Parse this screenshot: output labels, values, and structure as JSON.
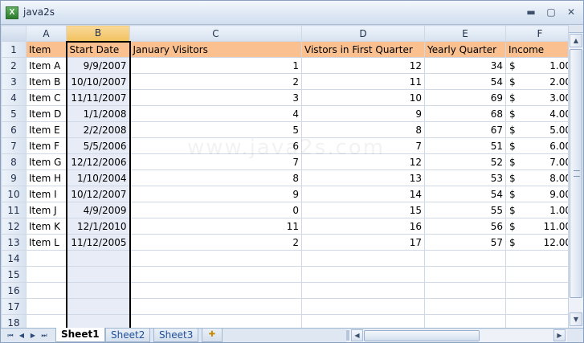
{
  "window": {
    "title": "java2s",
    "app_icon": "excel-icon",
    "minimize": "▬",
    "maximize": "▢",
    "close": "✕"
  },
  "watermark": "www.java2s.com",
  "columns": [
    "A",
    "B",
    "C",
    "D",
    "E",
    "F"
  ],
  "selected_column": "B",
  "rows": [
    "1",
    "2",
    "3",
    "4",
    "5",
    "6",
    "7",
    "8",
    "9",
    "10",
    "11",
    "12",
    "13",
    "14",
    "15",
    "16",
    "17",
    "18"
  ],
  "header": [
    "Item",
    "Start Date",
    "January Visitors",
    "Vistors in First Quarter",
    "Yearly Quarter",
    "Income"
  ],
  "data": [
    [
      "Item A",
      "9/9/2007",
      "1",
      "12",
      "34",
      "$",
      "1.00"
    ],
    [
      "Item B",
      "10/10/2007",
      "2",
      "11",
      "54",
      "$",
      "2.00"
    ],
    [
      "Item C",
      "11/11/2007",
      "3",
      "10",
      "69",
      "$",
      "3.00"
    ],
    [
      "Item D",
      "1/1/2008",
      "4",
      "9",
      "68",
      "$",
      "4.00"
    ],
    [
      "Item E",
      "2/2/2008",
      "5",
      "8",
      "67",
      "$",
      "5.00"
    ],
    [
      "Item F",
      "5/5/2006",
      "6",
      "7",
      "51",
      "$",
      "6.00"
    ],
    [
      "Item G",
      "12/12/2006",
      "7",
      "12",
      "52",
      "$",
      "7.00"
    ],
    [
      "Item H",
      "1/10/2004",
      "8",
      "13",
      "53",
      "$",
      "8.00"
    ],
    [
      "Item I",
      "10/12/2007",
      "9",
      "14",
      "54",
      "$",
      "9.00"
    ],
    [
      "Item J",
      "4/9/2009",
      "0",
      "15",
      "55",
      "$",
      "1.00"
    ],
    [
      "Item K",
      "12/1/2010",
      "11",
      "16",
      "56",
      "$",
      "11.00"
    ],
    [
      "Item L",
      "11/12/2005",
      "2",
      "17",
      "57",
      "$",
      "12.00"
    ]
  ],
  "sheets": [
    "Sheet1",
    "Sheet2",
    "Sheet3"
  ],
  "active_sheet": "Sheet1",
  "nav_buttons": [
    "⏮",
    "◀",
    "▶",
    "⏭"
  ],
  "scroll_arrows": {
    "up": "▲",
    "down": "▼",
    "left": "◀",
    "right": "▶"
  },
  "insert_sheet_icon": "insert-sheet-icon",
  "colors": {
    "header_fill": "#fac08f",
    "selected_column_fill": "#e8ecf6",
    "chrome": "#dfe7f2"
  }
}
